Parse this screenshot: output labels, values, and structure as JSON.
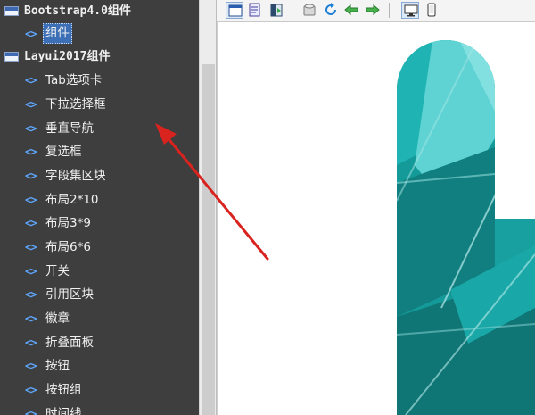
{
  "tree": {
    "categories": [
      {
        "label": "Bootstrap4.0组件"
      },
      {
        "label": "Layui2017组件"
      }
    ],
    "items": [
      {
        "label": "组件",
        "selected": true
      },
      {
        "label": "Tab选项卡"
      },
      {
        "label": "下拉选择框"
      },
      {
        "label": "垂直导航"
      },
      {
        "label": "复选框"
      },
      {
        "label": "字段集区块"
      },
      {
        "label": "布局2*10"
      },
      {
        "label": "布局3*9"
      },
      {
        "label": "布局6*6"
      },
      {
        "label": "开关"
      },
      {
        "label": "引用区块"
      },
      {
        "label": "徽章"
      },
      {
        "label": "折叠面板"
      },
      {
        "label": "按钮"
      },
      {
        "label": "按钮组"
      },
      {
        "label": "时间线"
      }
    ],
    "html_icon": "html-file-icon",
    "code_icon": "<>"
  },
  "toolbar": {
    "buttons": [
      "design-view-icon",
      "source-view-icon",
      "split-view-icon",
      "clear-icon",
      "refresh-icon",
      "back-icon",
      "forward-icon",
      "desktop-preview-icon",
      "mobile-preview-icon"
    ]
  },
  "colors": {
    "panel_bg": "#3e3e3e",
    "panel_text": "#f0f0f0",
    "code_icon": "#5fa8ff",
    "selection": "#3c6fb6",
    "arrow": "#d8231f",
    "teal_dark": "#12807f",
    "teal_mid": "#1aa3a3",
    "teal_light": "#5fd3d3"
  }
}
